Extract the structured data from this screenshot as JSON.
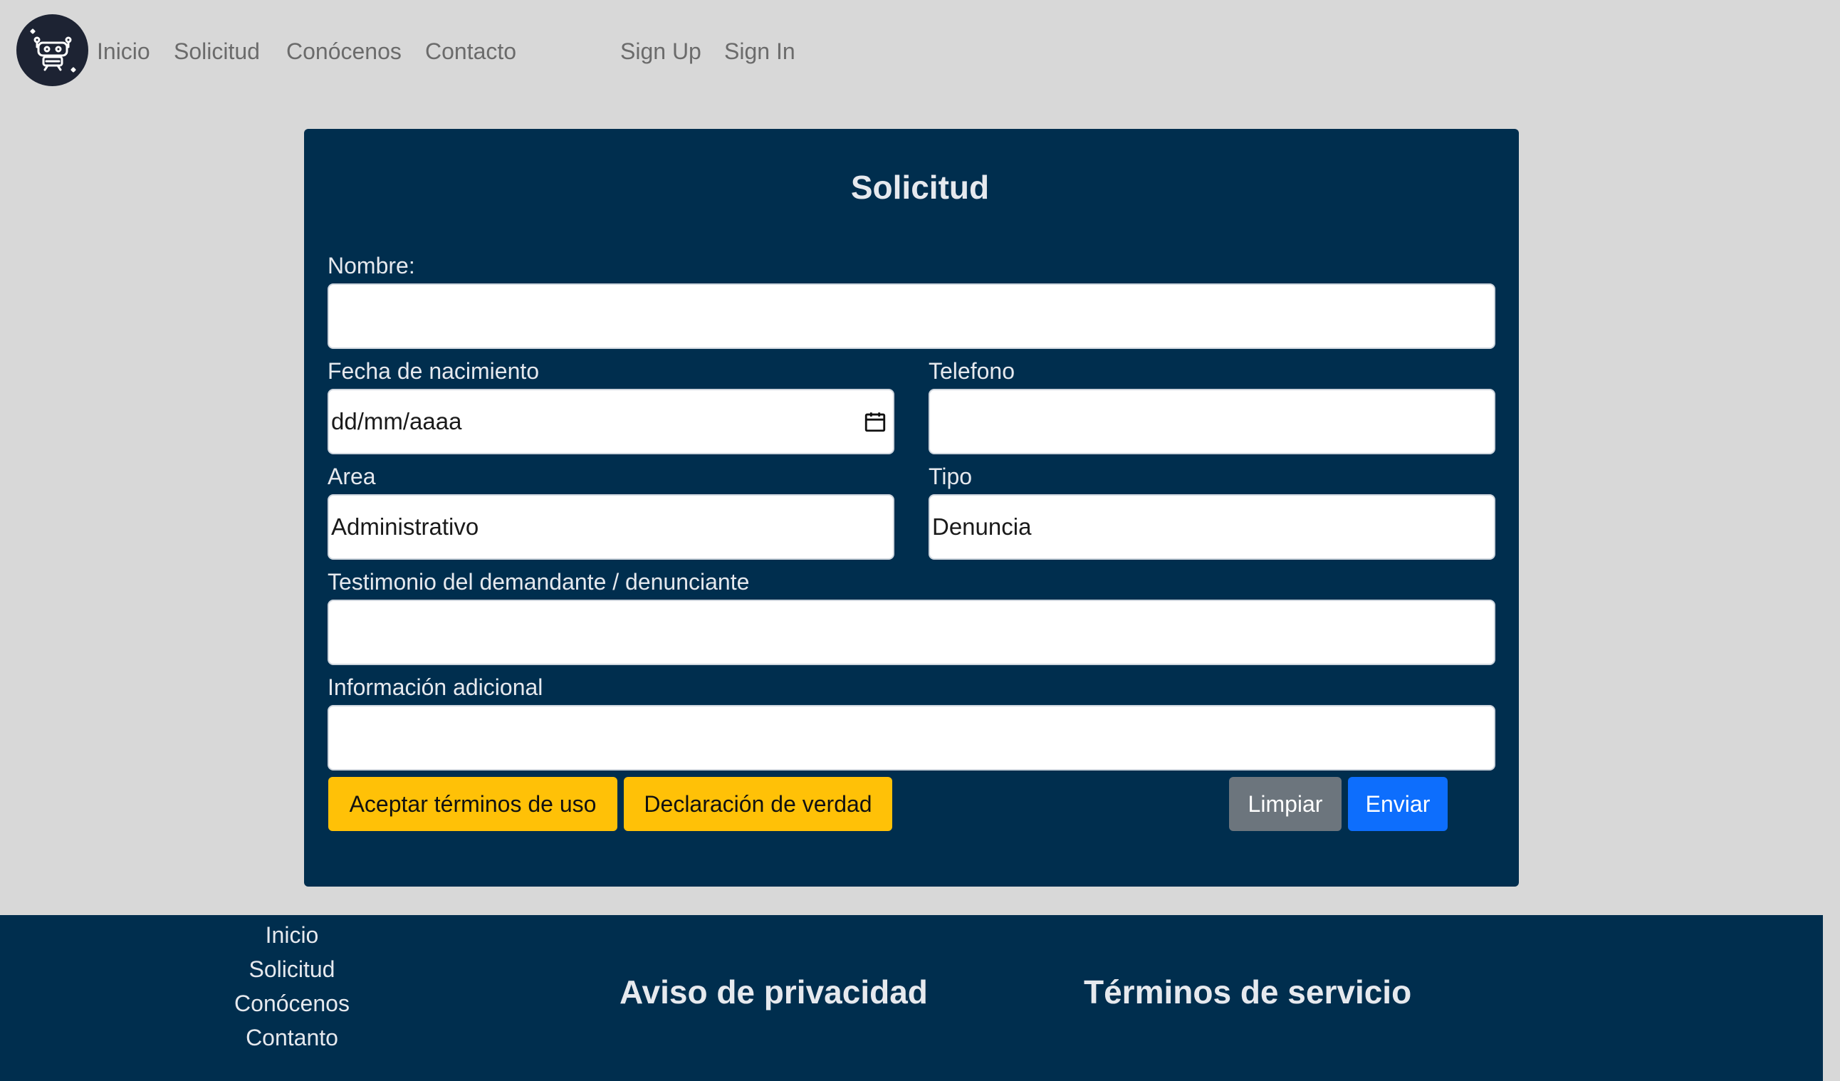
{
  "nav": {
    "items": [
      {
        "label": "Inicio"
      },
      {
        "label": "Solicitud"
      },
      {
        "label": "Conócenos"
      },
      {
        "label": "Contacto"
      }
    ],
    "auth": [
      {
        "label": "Sign Up"
      },
      {
        "label": "Sign In"
      }
    ]
  },
  "form": {
    "title": "Solicitud",
    "nombre": {
      "label": "Nombre:",
      "value": ""
    },
    "fecha": {
      "label": "Fecha de nacimiento",
      "placeholder": "dd/mm/aaaa"
    },
    "telefono": {
      "label": "Telefono",
      "value": ""
    },
    "area": {
      "label": "Area",
      "value": "Administrativo"
    },
    "tipo": {
      "label": "Tipo",
      "value": "Denuncia"
    },
    "testimonio": {
      "label": "Testimonio del demandante / denunciante",
      "value": ""
    },
    "info": {
      "label": "Información adicional",
      "value": ""
    },
    "buttons": {
      "terms": "Aceptar términos de uso",
      "declaration": "Declaración de verdad",
      "clear": "Limpiar",
      "submit": "Enviar"
    }
  },
  "footer": {
    "links": [
      {
        "label": "Inicio"
      },
      {
        "label": "Solicitud"
      },
      {
        "label": "Conócenos"
      },
      {
        "label": "Contanto"
      }
    ],
    "privacy": "Aviso de privacidad",
    "terms": "Términos de servicio"
  },
  "colors": {
    "page_bg": "#d8d8d8",
    "card_bg": "#002e4e",
    "footer_bg": "#002e4e",
    "yellow_button": "#ffc107",
    "gray_button": "#6c757d",
    "blue_button": "#0d6efd"
  },
  "icons": {
    "logo": "robot-logo-icon",
    "date_picker": "calendar-icon"
  }
}
